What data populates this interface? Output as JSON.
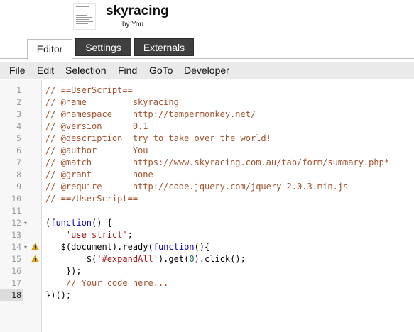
{
  "header": {
    "title": "skyracing",
    "byline": "by You"
  },
  "tabs": [
    {
      "label": "Editor",
      "active": true
    },
    {
      "label": "Settings",
      "active": false
    },
    {
      "label": "Externals",
      "active": false
    }
  ],
  "menu": [
    "File",
    "Edit",
    "Selection",
    "Find",
    "GoTo",
    "Developer"
  ],
  "code": {
    "active_line": 18,
    "lines": [
      {
        "n": "1",
        "text": "// ==UserScript=="
      },
      {
        "n": "2",
        "text": "// @name         skyracing"
      },
      {
        "n": "3",
        "text": "// @namespace    http://tampermonkey.net/"
      },
      {
        "n": "4",
        "text": "// @version      0.1"
      },
      {
        "n": "5",
        "text": "// @description  try to take over the world!"
      },
      {
        "n": "6",
        "text": "// @author       You"
      },
      {
        "n": "7",
        "text": "// @match        https://www.skyracing.com.au/tab/form/summary.php*"
      },
      {
        "n": "8",
        "text": "// @grant        none"
      },
      {
        "n": "9",
        "text": "// @require      http://code.jquery.com/jquery-2.0.3.min.js"
      },
      {
        "n": "10",
        "text": "// ==/UserScript=="
      },
      {
        "n": "11",
        "text": ""
      },
      {
        "n": "12",
        "text": "(function() {"
      },
      {
        "n": "13",
        "text": "    'use strict';"
      },
      {
        "n": "14",
        "text": "   $(document).ready(function(){"
      },
      {
        "n": "15",
        "text": "        $('#expandAll').get(0).click();"
      },
      {
        "n": "16",
        "text": "    });"
      },
      {
        "n": "17",
        "text": "    // Your code here..."
      },
      {
        "n": "18",
        "text": "})();"
      }
    ]
  },
  "colors": {
    "comment": "#a0522d",
    "string": "#a31515",
    "number": "#116644",
    "tab_inactive_bg": "#3f3f3f",
    "menubar_bg": "#eaeaea",
    "warning": "#e8a400"
  },
  "icons": {
    "fold_marker": "triangle-down-icon",
    "gutter_warning": "warning-icon"
  }
}
